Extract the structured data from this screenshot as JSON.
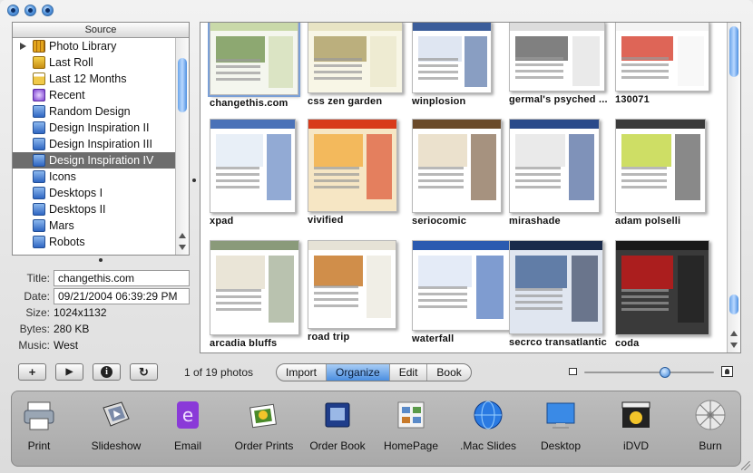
{
  "source": {
    "header": "Source",
    "items": [
      {
        "label": "Photo Library",
        "icon": "photo-library-icon",
        "type": "lib"
      },
      {
        "label": "Last Roll",
        "icon": "last-roll-icon",
        "type": "roll"
      },
      {
        "label": "Last 12 Months",
        "icon": "calendar-icon",
        "type": "cal"
      },
      {
        "label": "Recent",
        "icon": "recent-icon",
        "type": "recent"
      },
      {
        "label": "Random Design",
        "icon": "album-icon",
        "type": "album"
      },
      {
        "label": "Design Inspiration II",
        "icon": "album-icon",
        "type": "album"
      },
      {
        "label": "Design Inspiration III",
        "icon": "album-icon",
        "type": "album"
      },
      {
        "label": "Design Inspiration IV",
        "icon": "album-icon",
        "type": "album",
        "selected": true
      },
      {
        "label": "Icons",
        "icon": "album-icon",
        "type": "album"
      },
      {
        "label": "Desktops I",
        "icon": "album-icon",
        "type": "album"
      },
      {
        "label": "Desktops II",
        "icon": "album-icon",
        "type": "album"
      },
      {
        "label": "Mars",
        "icon": "album-icon",
        "type": "album"
      },
      {
        "label": "Robots",
        "icon": "album-icon",
        "type": "album"
      }
    ]
  },
  "info": {
    "title_label": "Title:",
    "title_value": "changethis.com",
    "date_label": "Date:",
    "date_value": "09/21/2004 06:39:29 PM",
    "size_label": "Size:",
    "size_value": "1024x1132",
    "bytes_label": "Bytes:",
    "bytes_value": "280 KB",
    "music_label": "Music:",
    "music_value": "West"
  },
  "photos": [
    {
      "caption": "changethis.com",
      "selected": true,
      "palette": [
        "#c9d9a9",
        "#7a9a5a",
        "#f4f6ee"
      ]
    },
    {
      "caption": "css zen garden",
      "palette": [
        "#e8e4c4",
        "#b0a26a",
        "#f8f6e6"
      ]
    },
    {
      "caption": "winplosion",
      "palette": [
        "#3b5d9a",
        "#d9e2f0",
        "#ffffff"
      ]
    },
    {
      "caption": "germal's psyched ...",
      "palette": [
        "#dcdcdc",
        "#6a6a6a",
        "#ffffff"
      ]
    },
    {
      "caption": "130071",
      "palette": [
        "#f4f4f4",
        "#d84a3a",
        "#ffffff"
      ]
    },
    {
      "caption": "xpad",
      "palette": [
        "#4a72b8",
        "#e4ecf6",
        "#ffffff"
      ]
    },
    {
      "caption": "vivified",
      "palette": [
        "#d83a1a",
        "#f2b04a",
        "#f6e6c4"
      ]
    },
    {
      "caption": "seriocomic",
      "palette": [
        "#6a4a2a",
        "#e8dcc4",
        "#ffffff"
      ]
    },
    {
      "caption": "mirashade",
      "palette": [
        "#2a4a8a",
        "#e6e6e6",
        "#ffffff"
      ]
    },
    {
      "caption": "adam polselli",
      "palette": [
        "#3a3a3a",
        "#c6d84a",
        "#ffffff"
      ]
    },
    {
      "caption": "arcadia bluffs",
      "palette": [
        "#8a9a7a",
        "#e6e0d0",
        "#ffffff"
      ]
    },
    {
      "caption": "road trip",
      "palette": [
        "#e6e2d6",
        "#c87a2a",
        "#ffffff"
      ]
    },
    {
      "caption": "waterfall",
      "palette": [
        "#2a5ab0",
        "#dfe8f6",
        "#ffffff"
      ]
    },
    {
      "caption": "secrco transatlantic",
      "palette": [
        "#1a2a4a",
        "#4a6a9a",
        "#e0e6f0"
      ]
    },
    {
      "caption": "coda",
      "palette": [
        "#1a1a1a",
        "#c01a1a",
        "#3a3a3a"
      ]
    }
  ],
  "toolbar": {
    "add_label": "+",
    "play_label": "▶",
    "info_label": "i",
    "rotate_label": "↻",
    "photo_count": "1 of 19 photos",
    "modes": [
      "Import",
      "Organize",
      "Edit",
      "Book"
    ],
    "active_mode": "Organize",
    "zoom_level": 0.62
  },
  "actions": [
    {
      "label": "Print",
      "icon": "printer-icon"
    },
    {
      "label": "Slideshow",
      "icon": "slideshow-icon"
    },
    {
      "label": "Email",
      "icon": "email-icon"
    },
    {
      "label": "Order Prints",
      "icon": "order-prints-icon"
    },
    {
      "label": "Order Book",
      "icon": "order-book-icon"
    },
    {
      "label": "HomePage",
      "icon": "homepage-icon"
    },
    {
      "label": ".Mac Slides",
      "icon": "mac-slides-icon"
    },
    {
      "label": "Desktop",
      "icon": "desktop-icon"
    },
    {
      "label": "iDVD",
      "icon": "idvd-icon"
    },
    {
      "label": "Burn",
      "icon": "burn-icon"
    }
  ]
}
